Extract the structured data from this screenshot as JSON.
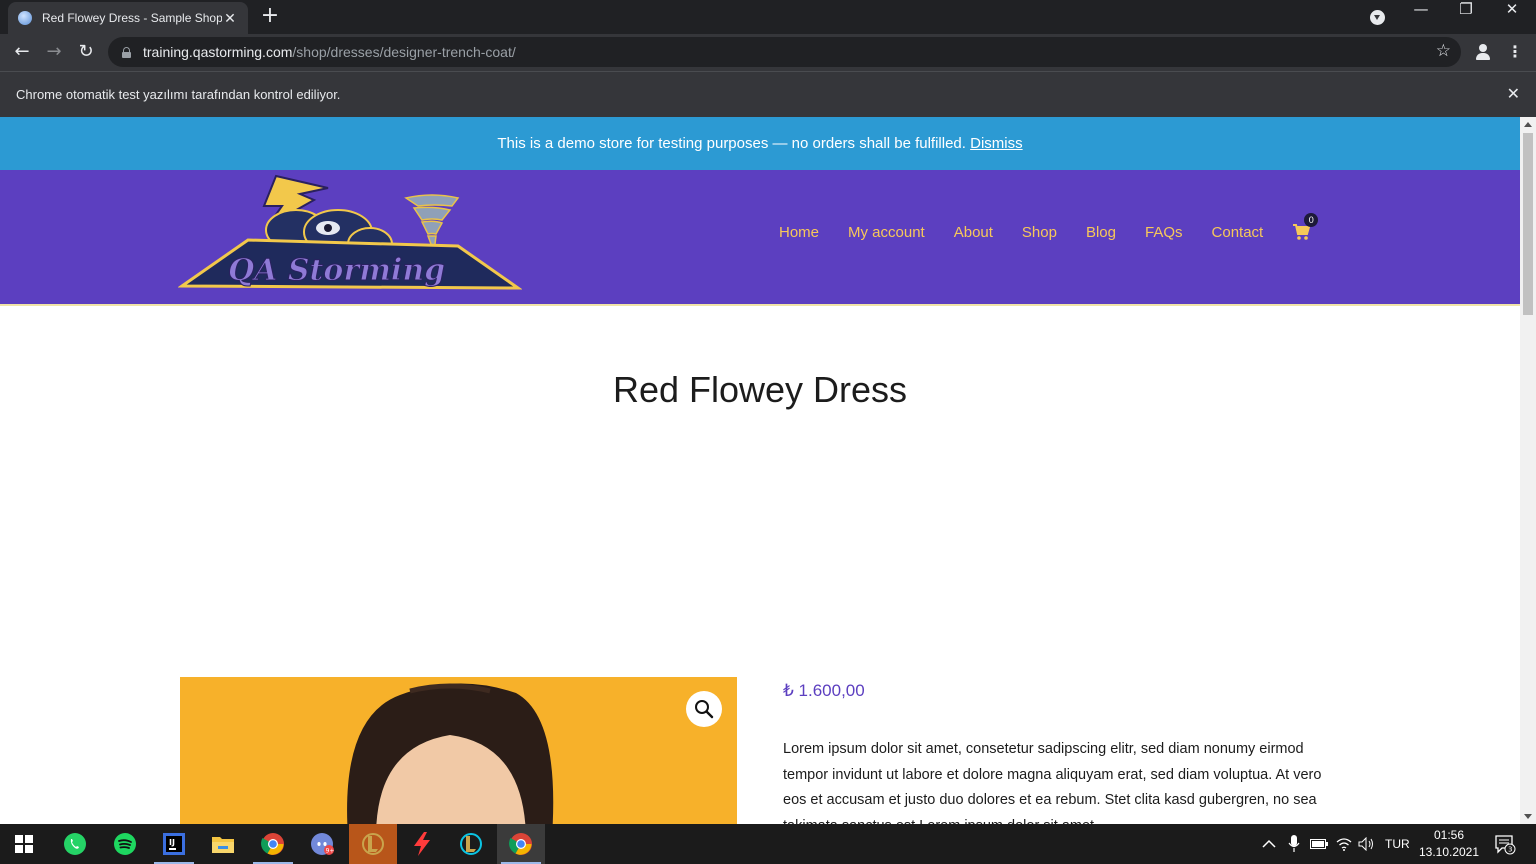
{
  "browser": {
    "tab_title": "Red Flowey Dress - Sample Shop",
    "url_host": "training.qastorming.com",
    "url_path": "/shop/dresses/designer-trench-coat/",
    "infobar_text": "Chrome otomatik test yazılımı tarafından kontrol ediliyor."
  },
  "store_notice": {
    "text": "This is a demo store for testing purposes — no orders shall be fulfilled. ",
    "dismiss_label": "Dismiss"
  },
  "header": {
    "logo_text": "QA Storming",
    "nav": [
      "Home",
      "My account",
      "About",
      "Shop",
      "Blog",
      "FAQs",
      "Contact"
    ],
    "cart_count": "0"
  },
  "product": {
    "title": "Red Flowey Dress",
    "price": "₺ 1.600,00",
    "description": "Lorem ipsum dolor sit amet, consetetur sadipscing elitr, sed diam nonumy eirmod tempor invidunt ut labore et dolore magna aliquyam erat, sed diam voluptua. At vero eos et accusam et justo duo dolores et ea rebum. Stet clita kasd gubergren, no sea takimata sanctus est Lorem ipsum dolor sit amet."
  },
  "taskbar": {
    "apps": [
      "whatsapp-icon",
      "spotify-icon",
      "intellij-icon",
      "file-explorer-icon",
      "chrome-icon",
      "discord-icon",
      "league-client-icon",
      "flash-icon",
      "league-icon",
      "chrome-icon"
    ],
    "discord_badge": "9+",
    "language": "TUR",
    "time": "01:56",
    "date": "13.10.2021",
    "notification_count": "3"
  },
  "colors": {
    "notice_bg": "#2c9ad3",
    "header_bg": "#5c3fc0",
    "nav_text": "#f7c85a",
    "price": "#5c3fc0"
  }
}
